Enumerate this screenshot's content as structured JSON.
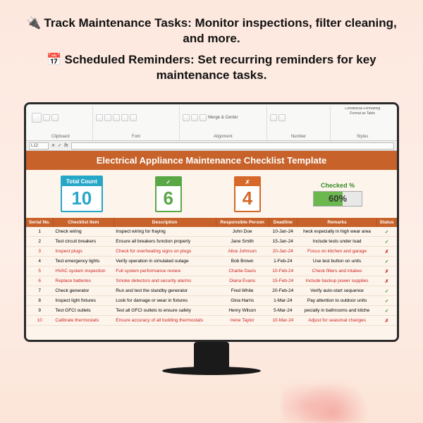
{
  "promo": {
    "line1_icon": "🔌",
    "line1": "Track Maintenance Tasks: Monitor inspections, filter cleaning, and more.",
    "line2_icon": "📅",
    "line2": "Scheduled Reminders: Set recurring reminders for key maintenance tasks."
  },
  "ribbon": {
    "groups": [
      "Clipboard",
      "Font",
      "Alignment",
      "Number",
      "Styles"
    ],
    "merge_label": "Merge & Center",
    "fmt_label": "Conditional Formatting",
    "tbl_label": "Format as Table"
  },
  "formula_bar": {
    "cell": "L12",
    "fx": "fx",
    "value": ""
  },
  "sheet": {
    "title": "Electrical Appliance Maintenance Checklist Template",
    "cards": {
      "total_label": "Total Count",
      "total_val": "10",
      "check_mark": "✓",
      "check_val": "6",
      "x_mark": "✗",
      "x_val": "4",
      "pct_label": "Checked %",
      "pct_val": "60%"
    },
    "headers": [
      "Serial No.",
      "Checklist Item",
      "Description",
      "Responsible Person",
      "Deadline",
      "Remarks",
      "Status"
    ],
    "rows": [
      {
        "n": "1",
        "item": "Check wiring",
        "desc": "Inspect wiring for fraying",
        "who": "John Doe",
        "due": "10-Jan-24",
        "rem": "heck especially in high wear area",
        "st": "✓",
        "red": false
      },
      {
        "n": "2",
        "item": "Test circuit breakers",
        "desc": "Ensure all breakers function properly",
        "who": "Jane Smith",
        "due": "15-Jan-24",
        "rem": "Include tests under load",
        "st": "✓",
        "red": false
      },
      {
        "n": "3",
        "item": "Inspect plugs",
        "desc": "Check for overheating signs on plugs",
        "who": "Alice Johnson",
        "due": "20-Jan-24",
        "rem": "Focus on kitchen and garage",
        "st": "✗",
        "red": true
      },
      {
        "n": "4",
        "item": "Test emergency lights",
        "desc": "Verify operation in simulated outage",
        "who": "Bob Brown",
        "due": "1-Feb-24",
        "rem": "Use test button on units",
        "st": "✓",
        "red": false
      },
      {
        "n": "5",
        "item": "HVAC system inspection",
        "desc": "Full system performance review",
        "who": "Charlie Davis",
        "due": "10-Feb-24",
        "rem": "Check filters and intakes",
        "st": "✗",
        "red": true
      },
      {
        "n": "6",
        "item": "Replace batteries",
        "desc": "Smoke detectors and security alarms",
        "who": "Diana Evans",
        "due": "15-Feb-24",
        "rem": "Include backup power supplies",
        "st": "✗",
        "red": true
      },
      {
        "n": "7",
        "item": "Check generator",
        "desc": "Run and test the standby generator",
        "who": "Fred White",
        "due": "20-Feb-24",
        "rem": "Verify auto-start sequence",
        "st": "✓",
        "red": false
      },
      {
        "n": "8",
        "item": "Inspect light fixtures",
        "desc": "Look for damage or wear in fixtures",
        "who": "Gina Harris",
        "due": "1-Mar-24",
        "rem": "Pay attention to outdoor units",
        "st": "✓",
        "red": false
      },
      {
        "n": "9",
        "item": "Test GFCI outlets",
        "desc": "Test all GFCI outlets to ensure safety",
        "who": "Henry Wilson",
        "due": "5-Mar-24",
        "rem": "pecially in bathrooms and kitche",
        "st": "✓",
        "red": false
      },
      {
        "n": "10",
        "item": "Calibrate thermostats",
        "desc": "Ensure accuracy of all building thermostats",
        "who": "Irene Taylor",
        "due": "10-Mar-24",
        "rem": "Adjust for seasonal changes",
        "st": "✗",
        "red": true
      }
    ]
  }
}
